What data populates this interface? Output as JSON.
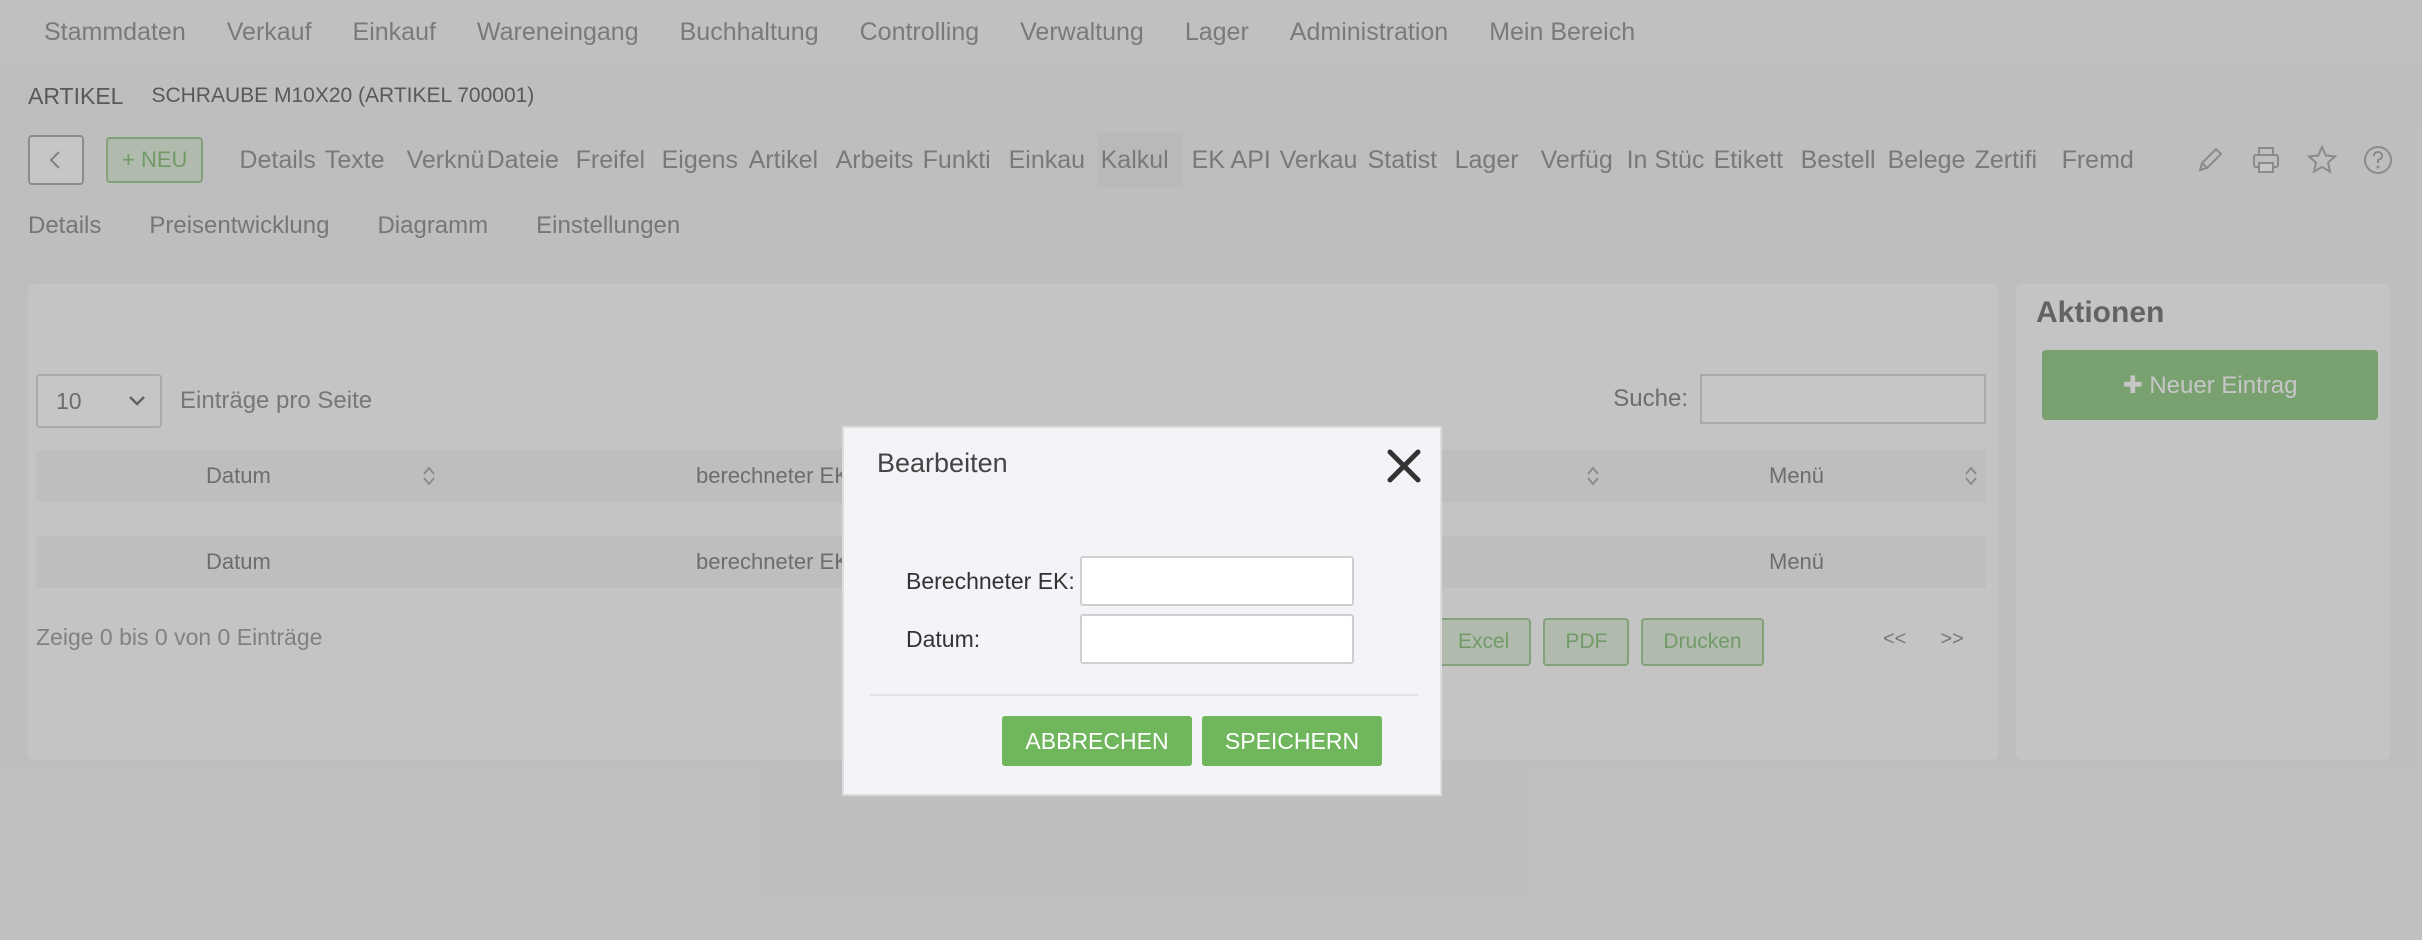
{
  "topnav": [
    "Stammdaten",
    "Verkauf",
    "Einkauf",
    "Wareneingang",
    "Buchhaltung",
    "Controlling",
    "Verwaltung",
    "Lager",
    "Administration",
    "Mein Bereich"
  ],
  "breadcrumb": {
    "section": "ARTIKEL",
    "item": "SCHRAUBE M10X20 (ARTIKEL 700001)"
  },
  "toolbar": {
    "new_label": "+ NEU",
    "tabs": [
      "Details",
      "Texte",
      "Verknü",
      "Dateie",
      "Freifel",
      "Eigens",
      "Artikel",
      "Arbeits",
      "Funkti",
      "Einkau",
      "Kalkul",
      "EK API",
      "Verkau",
      "Statist",
      "Lager",
      "Verfüg",
      "In Stüc",
      "Etikett",
      "Bestell",
      "Belege",
      "Zertifi",
      "Fremd"
    ],
    "active_tab": "Kalkul"
  },
  "subtabs": [
    "Details",
    "Preisentwicklung",
    "Diagramm",
    "Einstellungen"
  ],
  "table": {
    "per_page_value": "10",
    "per_page_label": "Einträge pro Seite",
    "search_label": "Suche:",
    "columns": [
      "Datum",
      "berechneter EK",
      "Menü"
    ],
    "info": "Zeige 0 bis 0 von 0 Einträge",
    "exports": [
      "Excel",
      "PDF",
      "Drucken"
    ],
    "pager": {
      "prev": "<<",
      "next": ">>"
    }
  },
  "side": {
    "title": "Aktionen",
    "new_entry_label": "✚ Neuer Eintrag"
  },
  "modal": {
    "title": "Bearbeiten",
    "field_ek_label": "Berechneter EK:",
    "field_ek_value": "",
    "field_date_label": "Datum:",
    "field_date_value": "",
    "cancel_label": "ABBRECHEN",
    "save_label": "SPEICHERN"
  },
  "colors": {
    "accent_green": "#6fb65c",
    "overlay": "#787878"
  }
}
